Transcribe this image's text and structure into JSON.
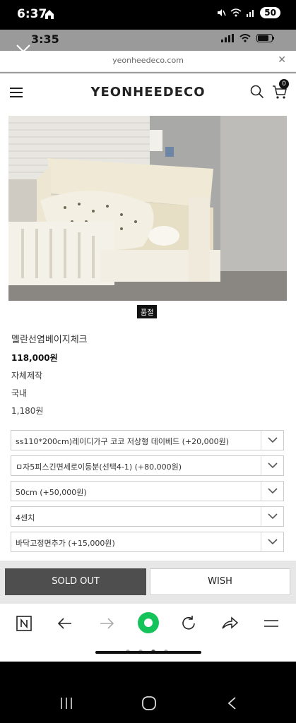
{
  "outer_status": {
    "time": "6:37",
    "battery": "50"
  },
  "inner_status": {
    "time": "3:35"
  },
  "url_bar": {
    "url": "yeonheedeco.com"
  },
  "header": {
    "brand": "YEONHEEDECO",
    "cart_count": "0"
  },
  "product": {
    "badge": "품절",
    "name": "멜란선염베이지체크",
    "price": "118,000원",
    "maker": "자체제작",
    "origin": "국내",
    "points": "1,180원"
  },
  "options": [
    {
      "label": "ss110*200cm)레이디가구 코코 저상형 데이베드 (+20,000원)"
    },
    {
      "label": "ㅁ자5피스긴면세로이등분(선택4-1) (+80,000원)"
    },
    {
      "label": "50cm (+50,000원)"
    },
    {
      "label": "4센치"
    },
    {
      "label": "바닥고정면추가 (+15,000원)"
    }
  ],
  "actions": {
    "sold_out": "SOLD OUT",
    "wish": "WISH"
  },
  "nav_icons": [
    "naver-n-icon",
    "back-arrow-icon",
    "forward-arrow-icon",
    "green-dot-icon",
    "refresh-icon",
    "share-icon",
    "menu-icon"
  ],
  "colors": {
    "soldout_bg": "#4e4e4e",
    "green": "#14c45a"
  }
}
